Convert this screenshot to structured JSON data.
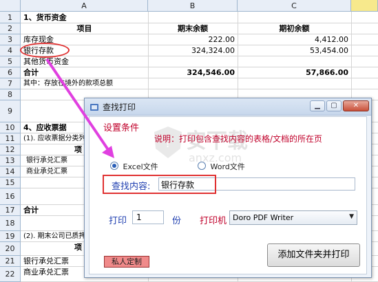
{
  "sheet": {
    "columns": [
      "A",
      "B",
      "C"
    ],
    "rows": [
      "1",
      "2",
      "3",
      "4",
      "5",
      "6",
      "7",
      "8",
      "9",
      "10",
      "11",
      "12",
      "13",
      "14",
      "15",
      "16",
      "17",
      "18",
      "19",
      "20",
      "21",
      "22"
    ],
    "r1": "1、货币资金",
    "r2": {
      "a": "项目",
      "b": "期末余额",
      "c": "期初余额"
    },
    "r3": {
      "a": "库存现金",
      "b": "222.00",
      "c": "4,412.00"
    },
    "r4": {
      "a": "银行存款",
      "b": "324,324.00",
      "c": "53,454.00"
    },
    "r5": {
      "a": "其他货币资金"
    },
    "r6": {
      "a": "合计",
      "b": "324,546.00",
      "c": "57,866.00"
    },
    "r7": "其中：存放在境外的款项总额",
    "r10": "4、应收票据",
    "r11": "(1). 应收票据分类列",
    "r12": "项",
    "r13": "银行承兑汇票",
    "r14": "商业承兑汇票",
    "r17": "合计",
    "r19": "(2). 期末公司已质押",
    "r20": "项",
    "r21": "银行承兑汇票",
    "r22": "商业承兑汇票"
  },
  "dialog": {
    "title": "查找打印",
    "section_label": "设置条件",
    "note": "说明：打印包含查找内容的表格/文档的所在页",
    "radio_excel": "Excel文件",
    "radio_word": "Word文件",
    "excel_selected": true,
    "find_label": "查找内容:",
    "find_value": "银行存款",
    "print_label": "打印",
    "copies": "1",
    "copies_unit": "份",
    "printer_label": "打印机",
    "printer_value": "Doro PDF Writer",
    "custom_button": "私人定制",
    "add_button": "添加文件夹并打印"
  },
  "watermark": {
    "text": "安下载",
    "sub": "anxz.com"
  },
  "colors": {
    "accent_red": "#c0002a",
    "label_blue": "#1f3fb0",
    "annotation": "#e040e0",
    "highlight": "#e03030"
  }
}
